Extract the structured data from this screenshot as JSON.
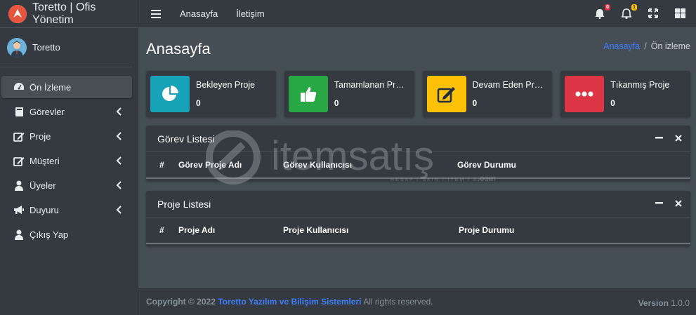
{
  "brand": {
    "title": "Toretto | Ofis Yönetim"
  },
  "user": {
    "name": "Toretto"
  },
  "sidebar": {
    "items": [
      {
        "label": "Ön İzleme",
        "icon": "dashboard-icon"
      },
      {
        "label": "Görevler",
        "icon": "book-icon"
      },
      {
        "label": "Proje",
        "icon": "edit-icon"
      },
      {
        "label": "Müşteri",
        "icon": "edit-icon"
      },
      {
        "label": "Üyeler",
        "icon": "user-icon"
      },
      {
        "label": "Duyuru",
        "icon": "bullhorn-icon"
      },
      {
        "label": "Çıkış Yap",
        "icon": "user-icon"
      }
    ]
  },
  "topbar": {
    "links": [
      "Anasayfa",
      "İletişim"
    ],
    "notif_badge_1": "0",
    "notif_badge_2": "1"
  },
  "page": {
    "title": "Anasayfa",
    "breadcrumb_link": "Anasayfa",
    "breadcrumb_sep": "/",
    "breadcrumb_current": "Ön izleme"
  },
  "info_boxes": [
    {
      "label": "Bekleyen Proje",
      "value": "0",
      "color": "#17a2b8",
      "icon": "pie-chart-icon"
    },
    {
      "label": "Tamamlanan Proje",
      "value": "0",
      "color": "#28a745",
      "icon": "thumbs-up-icon"
    },
    {
      "label": "Devam Eden Proje",
      "value": "0",
      "color": "#ffc107",
      "icon": "edit-icon"
    },
    {
      "label": "Tıkanmış Proje",
      "value": "0",
      "color": "#dc3545",
      "icon": "ellipsis-icon"
    }
  ],
  "tasks_card": {
    "title": "Görev Listesi",
    "columns": [
      "#",
      "Görev Proje Adı",
      "Görev Kullanıcısı",
      "Görev Durumu"
    ]
  },
  "projects_card": {
    "title": "Proje Listesi",
    "columns": [
      "#",
      "Proje Adı",
      "Proje Kullanıcısı",
      "Proje Durumu"
    ]
  },
  "footer": {
    "copyright": "Copyright © 2022",
    "company": "Toretto Yazılım ve Bilişim Sistemleri",
    "rights": "All rights reserved.",
    "version_label": "Version",
    "version": "1.0.0"
  },
  "watermark": {
    "text": "itemsatış",
    "subtext": "HESAP / SKIN / ITEM / E-PIN",
    "suffix": ".com"
  }
}
